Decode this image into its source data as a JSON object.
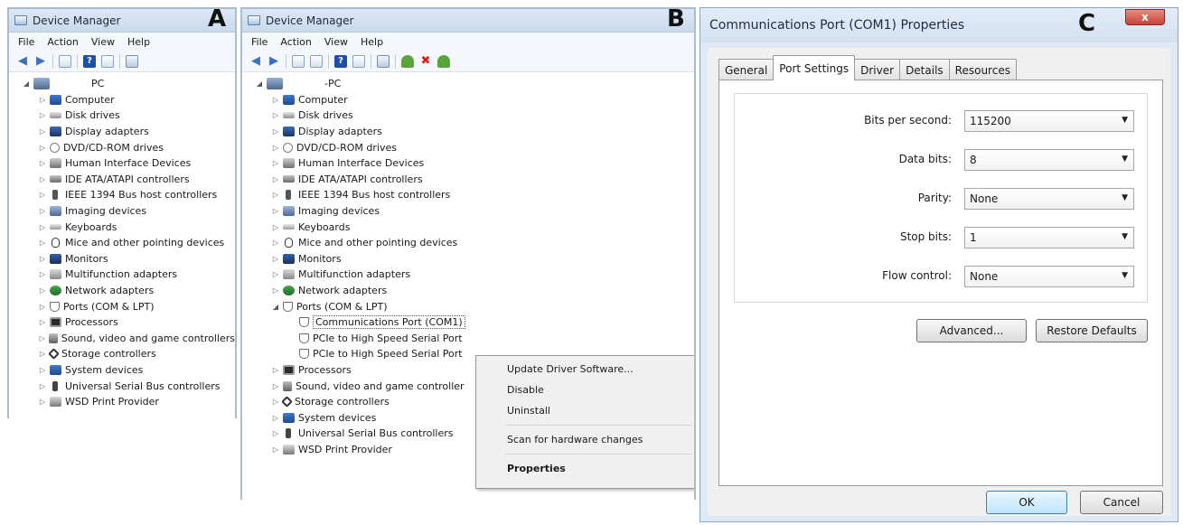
{
  "panel_a": {
    "letter": "A",
    "title": "Device Manager",
    "menu": [
      "File",
      "Action",
      "View",
      "Help"
    ],
    "root": "PC",
    "items": [
      {
        "label": "Computer",
        "icon": "computer-icon"
      },
      {
        "label": "Disk drives",
        "icon": "disk-drive-icon"
      },
      {
        "label": "Display adapters",
        "icon": "display-adapter-icon"
      },
      {
        "label": "DVD/CD-ROM drives",
        "icon": "dvd-drive-icon"
      },
      {
        "label": "Human Interface Devices",
        "icon": "hid-icon"
      },
      {
        "label": "IDE ATA/ATAPI controllers",
        "icon": "ide-controller-icon"
      },
      {
        "label": "IEEE 1394 Bus host controllers",
        "icon": "ieee1394-icon"
      },
      {
        "label": "Imaging devices",
        "icon": "imaging-device-icon"
      },
      {
        "label": "Keyboards",
        "icon": "keyboard-icon"
      },
      {
        "label": "Mice and other pointing devices",
        "icon": "mouse-icon"
      },
      {
        "label": "Monitors",
        "icon": "monitor-icon"
      },
      {
        "label": "Multifunction adapters",
        "icon": "multifunction-adapter-icon"
      },
      {
        "label": "Network adapters",
        "icon": "network-adapter-icon"
      },
      {
        "label": "Ports (COM & LPT)",
        "icon": "port-icon"
      },
      {
        "label": "Processors",
        "icon": "processor-icon"
      },
      {
        "label": "Sound, video and game controllers",
        "icon": "sound-icon"
      },
      {
        "label": "Storage controllers",
        "icon": "storage-controller-icon"
      },
      {
        "label": "System devices",
        "icon": "system-device-icon"
      },
      {
        "label": "Universal Serial Bus controllers",
        "icon": "usb-icon"
      },
      {
        "label": "WSD Print Provider",
        "icon": "print-provider-icon"
      }
    ]
  },
  "panel_b": {
    "letter": "B",
    "title": "Device Manager",
    "menu": [
      "File",
      "Action",
      "View",
      "Help"
    ],
    "root": "-PC",
    "items": [
      {
        "label": "Computer",
        "icon": "computer-icon"
      },
      {
        "label": "Disk drives",
        "icon": "disk-drive-icon"
      },
      {
        "label": "Display adapters",
        "icon": "display-adapter-icon"
      },
      {
        "label": "DVD/CD-ROM drives",
        "icon": "dvd-drive-icon"
      },
      {
        "label": "Human Interface Devices",
        "icon": "hid-icon"
      },
      {
        "label": "IDE ATA/ATAPI controllers",
        "icon": "ide-controller-icon"
      },
      {
        "label": "IEEE 1394 Bus host controllers",
        "icon": "ieee1394-icon"
      },
      {
        "label": "Imaging devices",
        "icon": "imaging-device-icon"
      },
      {
        "label": "Keyboards",
        "icon": "keyboard-icon"
      },
      {
        "label": "Mice and other pointing devices",
        "icon": "mouse-icon"
      },
      {
        "label": "Monitors",
        "icon": "monitor-icon"
      },
      {
        "label": "Multifunction adapters",
        "icon": "multifunction-adapter-icon"
      },
      {
        "label": "Network adapters",
        "icon": "network-adapter-icon"
      },
      {
        "label": "Ports (COM & LPT)",
        "icon": "port-icon",
        "expanded": true,
        "children": [
          {
            "label": "Communications Port (COM1)",
            "icon": "port-icon",
            "selected": true
          },
          {
            "label": "PCIe to High Speed Serial Port",
            "icon": "port-icon"
          },
          {
            "label": "PCIe to High Speed Serial Port",
            "icon": "port-icon"
          }
        ]
      },
      {
        "label": "Processors",
        "icon": "processor-icon"
      },
      {
        "label": "Sound, video and game controller",
        "icon": "sound-icon"
      },
      {
        "label": "Storage controllers",
        "icon": "storage-controller-icon"
      },
      {
        "label": "System devices",
        "icon": "system-device-icon"
      },
      {
        "label": "Universal Serial Bus controllers",
        "icon": "usb-icon"
      },
      {
        "label": "WSD Print Provider",
        "icon": "print-provider-icon"
      }
    ],
    "context_menu": {
      "items": [
        {
          "label": "Update Driver Software..."
        },
        {
          "label": "Disable"
        },
        {
          "label": "Uninstall",
          "separator_after": true
        },
        {
          "label": "Scan for hardware changes",
          "separator_after": true
        },
        {
          "label": "Properties",
          "bold": true
        }
      ]
    }
  },
  "panel_c": {
    "letter": "C",
    "title": "Communications Port (COM1) Properties",
    "close_label": "x",
    "tabs": [
      "General",
      "Port Settings",
      "Driver",
      "Details",
      "Resources"
    ],
    "active_tab": "Port Settings",
    "fields": [
      {
        "label": "Bits per second:",
        "value": "115200"
      },
      {
        "label": "Data bits:",
        "value": "8"
      },
      {
        "label": "Parity:",
        "value": "None"
      },
      {
        "label": "Stop bits:",
        "value": "1"
      },
      {
        "label": "Flow control:",
        "value": "None"
      }
    ],
    "buttons": {
      "advanced": "Advanced...",
      "restore": "Restore Defaults",
      "ok": "OK",
      "cancel": "Cancel"
    }
  }
}
